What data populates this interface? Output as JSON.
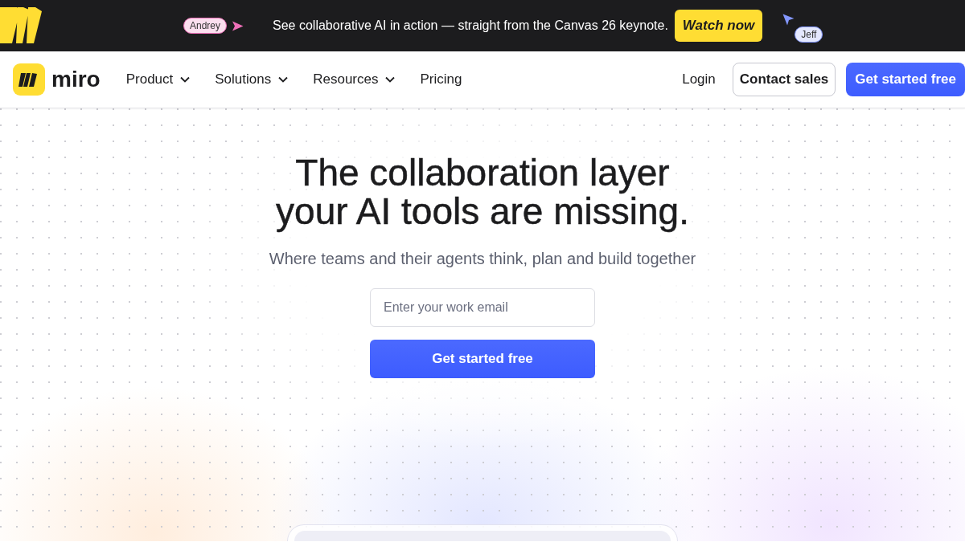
{
  "banner": {
    "collaborators": [
      {
        "name": "Andrey",
        "color": "#ee6fb8",
        "kind": "arrow"
      },
      {
        "name": "Jeff",
        "color": "#8397ff",
        "kind": "cursor"
      }
    ],
    "message": "See collaborative AI in action — straight from the Canvas 26 keynote.",
    "button": "Watch now"
  },
  "nav": {
    "logo": "miro",
    "items": [
      {
        "label": "Product",
        "kind": "menu"
      },
      {
        "label": "Solutions",
        "kind": "menu"
      },
      {
        "label": "Resources",
        "kind": "menu"
      },
      {
        "label": "Pricing",
        "kind": "link"
      }
    ],
    "login": "Login",
    "contact_button": "Contact sales",
    "cta_button": "Get started free"
  },
  "hero": {
    "title": "The collaboration layer your AI tools are missing.",
    "subtitle": "Where teams and their agents think, plan and build together",
    "email_field": {
      "placeholder": "Enter your work email"
    },
    "button": "Get started free"
  }
}
